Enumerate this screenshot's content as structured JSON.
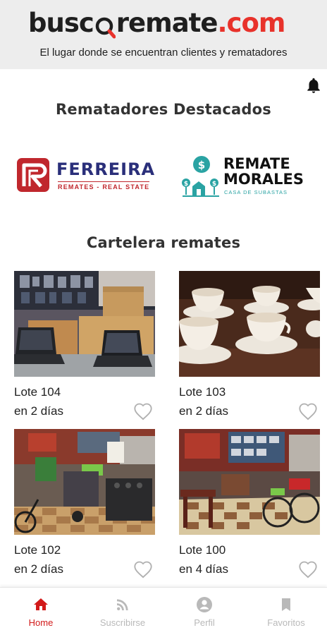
{
  "brand": {
    "logo_part1": "busc",
    "logo_part2": "remate",
    "logo_part3": ".com",
    "tagline": "El lugar donde se encuentran clientes y rematadores",
    "accent_color": "#e8322b"
  },
  "sections": {
    "featured_title": "Rematadores Destacados",
    "billboard_title": "Cartelera remates"
  },
  "partners": [
    {
      "name": "FERREIRA",
      "subtitle": "REMATES - REAL STATE",
      "color": "#2a2f7a",
      "icon_color": "#c0272d"
    },
    {
      "name_line1": "REMATE",
      "name_line2": "MORALES",
      "subtitle": "CASA DE SUBASTAS",
      "color": "#111111",
      "icon_color": "#2aa3a3"
    }
  ],
  "lots": [
    {
      "title": "Lote 104",
      "time": "en 2 días",
      "image": "laptops-and-boxes",
      "favorite": false
    },
    {
      "title": "Lote 103",
      "time": "en 2 días",
      "image": "teacups-and-saucers",
      "favorite": false
    },
    {
      "title": "Lote 102",
      "time": "en 2 días",
      "image": "warehouse-bikes-and-furniture",
      "favorite": false
    },
    {
      "title": "Lote 100",
      "time": "en 4 días",
      "image": "warehouse-tables-and-bicycles",
      "favorite": false
    }
  ],
  "tabs": [
    {
      "label": "Home",
      "icon": "home-icon",
      "active": true
    },
    {
      "label": "Suscribirse",
      "icon": "rss-icon",
      "active": false
    },
    {
      "label": "Perfil",
      "icon": "user-icon",
      "active": false
    },
    {
      "label": "Favoritos",
      "icon": "bookmark-icon",
      "active": false
    }
  ],
  "colors": {
    "active_tab": "#d21a1a",
    "inactive_tab": "#b9b9b9",
    "header_bg": "#ededed"
  }
}
